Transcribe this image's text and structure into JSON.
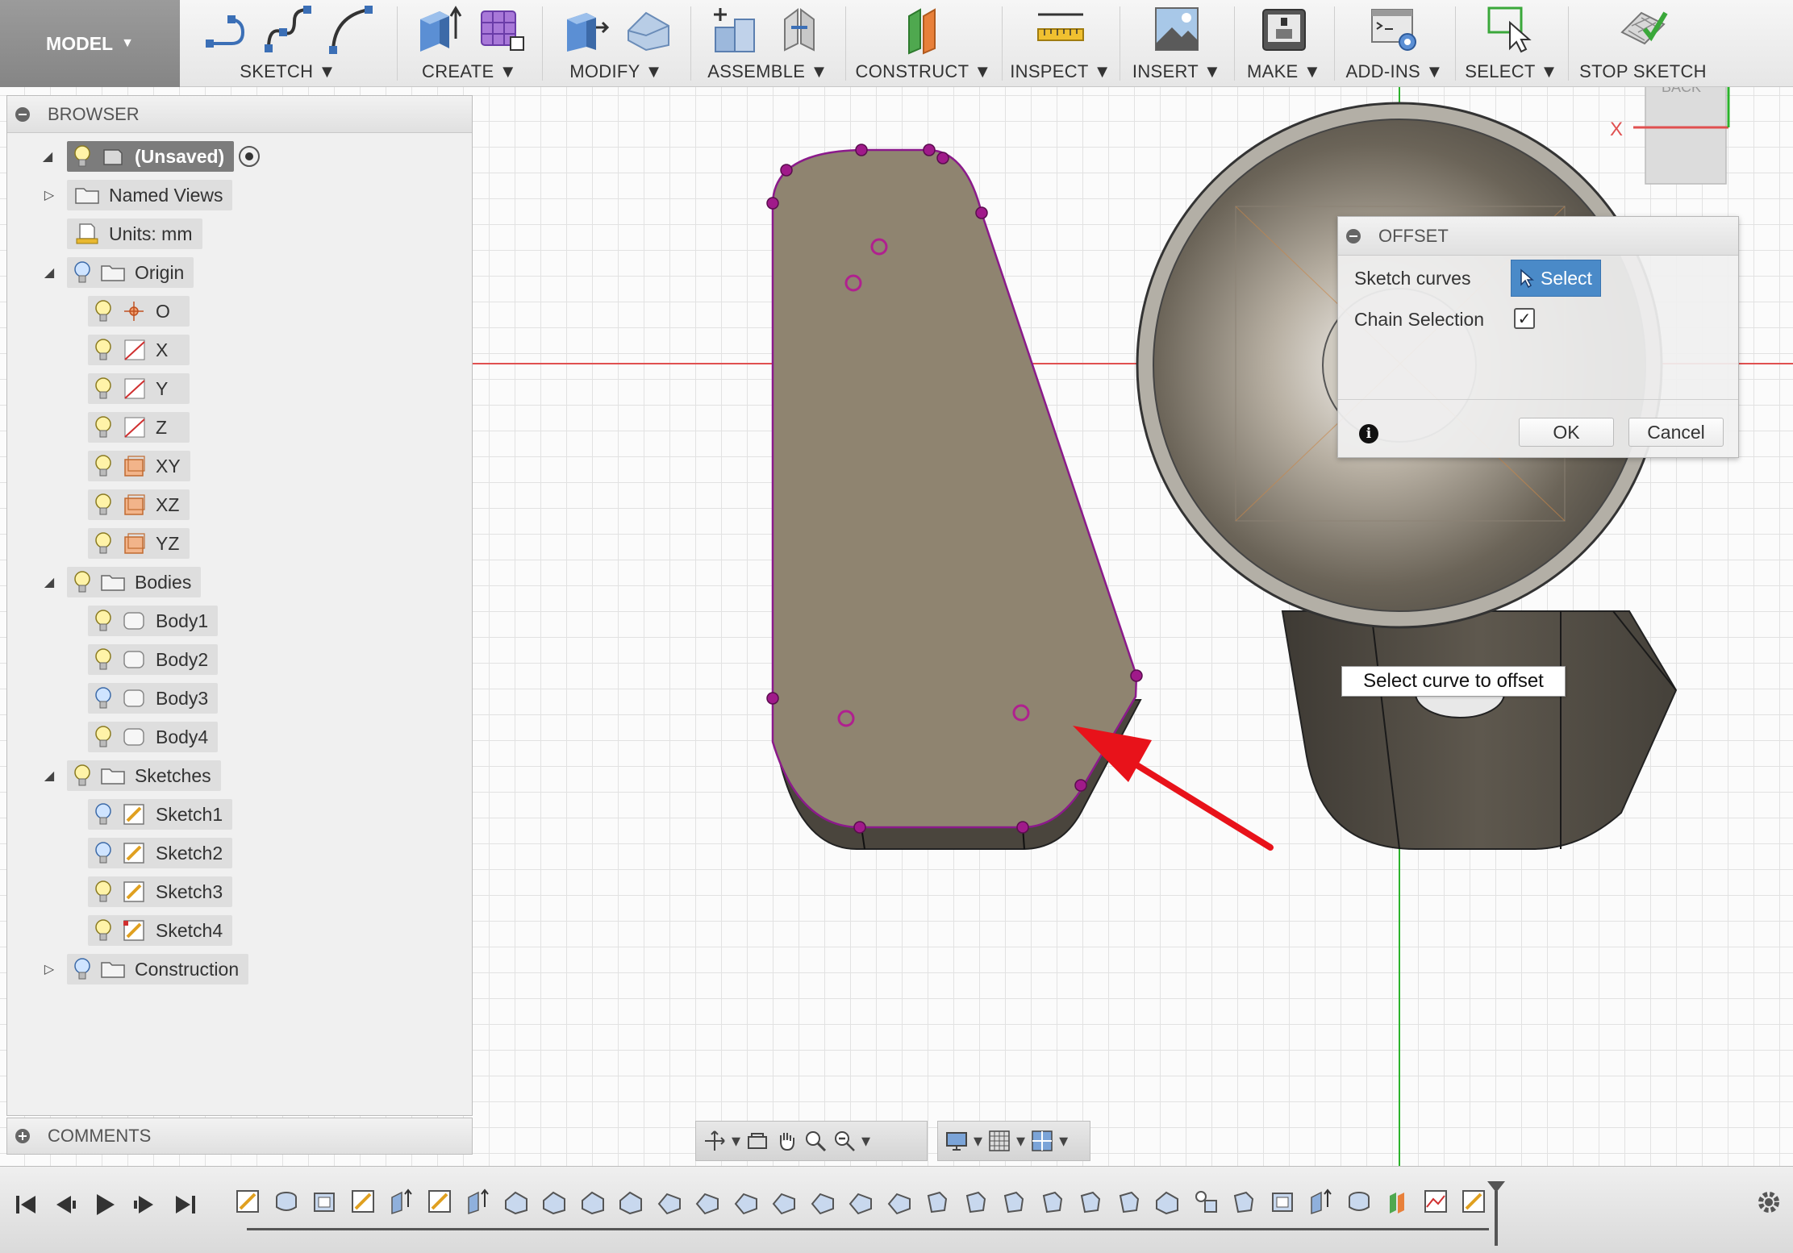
{
  "toolbar": {
    "workspace": "MODEL",
    "groups": [
      {
        "label": "SKETCH"
      },
      {
        "label": "CREATE"
      },
      {
        "label": "MODIFY"
      },
      {
        "label": "ASSEMBLE"
      },
      {
        "label": "CONSTRUCT"
      },
      {
        "label": "INSPECT"
      },
      {
        "label": "INSERT"
      },
      {
        "label": "MAKE"
      },
      {
        "label": "ADD-INS"
      },
      {
        "label": "SELECT"
      },
      {
        "label": "STOP SKETCH"
      }
    ]
  },
  "browser": {
    "title": "BROWSER",
    "root": "(Unsaved)",
    "named_views": "Named Views",
    "units": "Units: mm",
    "origin": {
      "label": "Origin",
      "items": [
        "O",
        "X",
        "Y",
        "Z",
        "XY",
        "XZ",
        "YZ"
      ]
    },
    "bodies": {
      "label": "Bodies",
      "items": [
        "Body1",
        "Body2",
        "Body3",
        "Body4"
      ]
    },
    "sketches": {
      "label": "Sketches",
      "items": [
        "Sketch1",
        "Sketch2",
        "Sketch3",
        "Sketch4"
      ]
    },
    "construction": "Construction"
  },
  "comments": {
    "title": "COMMENTS"
  },
  "offset_dialog": {
    "title": "OFFSET",
    "sketch_curves_label": "Sketch curves",
    "select_label": "Select",
    "chain_selection_label": "Chain Selection",
    "chain_selection_checked": true,
    "ok_label": "OK",
    "cancel_label": "Cancel"
  },
  "tooltip": "Select curve to offset",
  "viewcube": {
    "face_label": "BACK",
    "axis_x": "X"
  },
  "colors": {
    "sketch_profile": "#8f8470",
    "sketch_line": "#8b1a8b",
    "annotation_arrow": "#e8121a",
    "select_button": "#4a8ac8",
    "x_axis": "#e05050",
    "y_axis": "#2bb22b"
  }
}
